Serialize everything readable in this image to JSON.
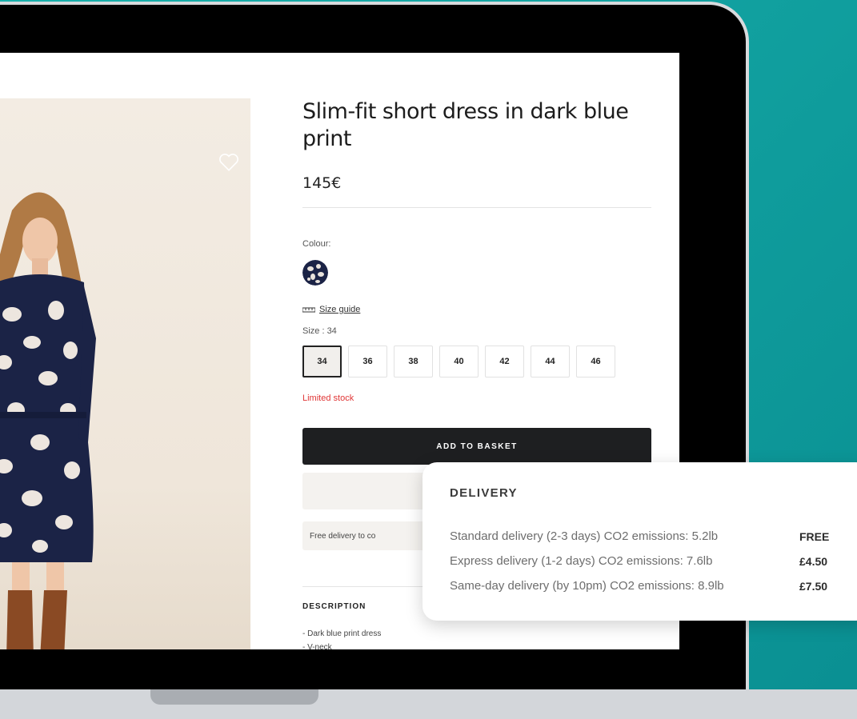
{
  "product": {
    "title": "Slim-fit short dress in dark blue print",
    "price": "145€",
    "colour_label": "Colour:",
    "size_guide": "Size guide",
    "size_label": "Size : 34",
    "sizes": [
      "34",
      "36",
      "38",
      "40",
      "42",
      "44",
      "46"
    ],
    "selected_size": "34",
    "stock_status": "Limited stock",
    "add_to_basket": "ADD TO BASKET",
    "free_delivery": "Free delivery to co",
    "description_title": "DESCRIPTION",
    "description_items": [
      "- Dark blue print dress",
      "- V-neck"
    ]
  },
  "delivery": {
    "title": "DELIVERY",
    "options": [
      {
        "label": "Standard delivery (2-3 days) CO2 emissions: 5.2lb",
        "price": "FREE"
      },
      {
        "label": "Express delivery (1-2 days) CO2 emissions: 7.6lb",
        "price": "£4.50"
      },
      {
        "label": "Same-day delivery (by 10pm) CO2 emissions: 8.9lb",
        "price": "£7.50"
      }
    ]
  },
  "colors": {
    "background": "#12a6a5",
    "button": "#1e1f21",
    "stock_warning": "#e03535",
    "navy_print": "#1b2346"
  },
  "icons": {
    "wishlist": "heart-outline-icon",
    "size_guide": "ruler-icon",
    "swatch": "dark-blue-print-swatch"
  }
}
